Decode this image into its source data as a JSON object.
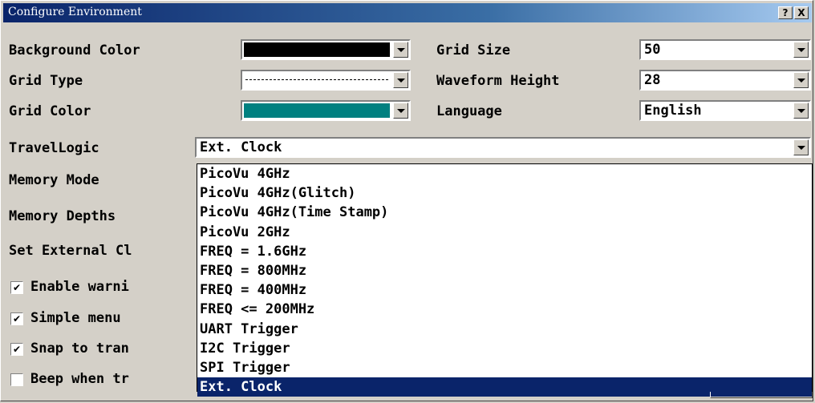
{
  "window": {
    "title": "Configure Environment"
  },
  "titlebar_buttons": {
    "help": "?",
    "close": "X"
  },
  "background_color": {
    "label": "Background Color",
    "color": "#000000"
  },
  "grid_type": {
    "label": "Grid Type",
    "value": "dashed"
  },
  "grid_color": {
    "label": "Grid Color",
    "color": "#008080"
  },
  "grid_size": {
    "label": "Grid Size",
    "value": "50"
  },
  "waveform_height": {
    "label": "Waveform Height",
    "value": "28"
  },
  "language": {
    "label": "Language",
    "value": "English"
  },
  "travel_logic": {
    "label": "TravelLogic",
    "value": "Ext. Clock",
    "options": [
      "PicoVu 4GHz",
      "PicoVu 4GHz(Glitch)",
      "PicoVu 4GHz(Time Stamp)",
      "PicoVu 2GHz",
      "FREQ = 1.6GHz",
      "FREQ = 800MHz",
      "FREQ = 400MHz",
      "FREQ <= 200MHz",
      "UART Trigger",
      "I2C Trigger",
      "SPI Trigger",
      "Ext. Clock"
    ],
    "selected_index": 11
  },
  "memory_mode": {
    "label": "Memory Mode"
  },
  "memory_depths": {
    "label": "Memory Depths"
  },
  "set_external_clock": {
    "label": "Set External Cl"
  },
  "checkboxes": [
    {
      "label": "Enable warni",
      "checked": true
    },
    {
      "label": "Simple menu",
      "checked": true
    },
    {
      "label": "Snap to tran",
      "checked": true
    },
    {
      "label": "Beep when tr",
      "checked": false
    }
  ],
  "check_glyph": "✔",
  "colors": {
    "titlebar_start": "#0a246a",
    "selection": "#0a246a",
    "face": "#d4d0c8"
  }
}
